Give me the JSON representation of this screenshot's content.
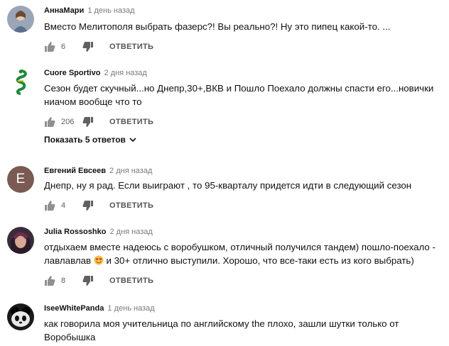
{
  "comments": [
    {
      "author": "АннаМари",
      "time": "1 день назад",
      "text": "Вместо Мелитополя выбрать фазерс?! Вы реально?! Ну это пипец какой-то. ...",
      "likes": "6",
      "reply": "ОТВЕТИТЬ"
    },
    {
      "author": "Cuore Sportivo",
      "time": "2 дня назад",
      "text": "Сезон будет скучный...но Днепр,30+,ВКВ и Пошло Поехало должны спасти его...новички ниачом вообще что то",
      "likes": "206",
      "reply": "ОТВЕТИТЬ",
      "show_replies": "Показать 5 ответов"
    },
    {
      "author": "Евгений Евсеев",
      "time": "2 дня назад",
      "avatar_letter": "E",
      "text": "Днепр, ну я рад. Если выиграют , то 95-кварталу придется идти в следующий сезон",
      "likes": "4",
      "reply": "ОТВЕТИТЬ"
    },
    {
      "author": "Julia Rossoshko",
      "time": "2 дня назад",
      "text_line1": "отдыхаем вместе  надеюсь с воробушком, отличный получился тандем) пошло-поехало -",
      "text_line2a": "лавлавлав",
      "text_line2b": "и 30+ отлично выступили.  Хорошо, что все-таки есть из кого выбрать)",
      "likes": "8",
      "reply": "ОТВЕТИТЬ"
    },
    {
      "author": "IseeWhitePanda",
      "time": "1 день назад",
      "text": "как говорила моя учительница по английскому the плохо, зашли шутки только от Воробышка"
    }
  ]
}
